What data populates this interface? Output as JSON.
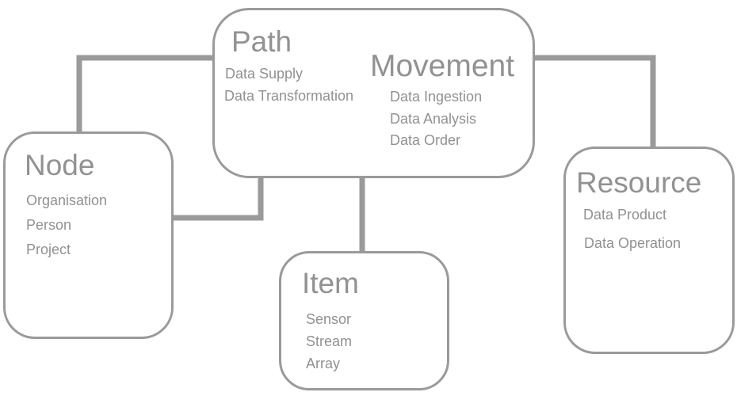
{
  "colors": {
    "line": "#9a9a9a",
    "text": "#919191"
  },
  "nodes": {
    "path": {
      "title": "Path",
      "items": [
        "Data Supply",
        "Data Transformation"
      ]
    },
    "movement": {
      "title": "Movement",
      "items": [
        "Data Ingestion",
        "Data Analysis",
        "Data Order"
      ]
    },
    "node": {
      "title": "Node",
      "items": [
        "Organisation",
        "Person",
        "Project"
      ]
    },
    "item": {
      "title": "Item",
      "items": [
        "Sensor",
        "Stream",
        "Array"
      ]
    },
    "resource": {
      "title": "Resource",
      "items": [
        "Data Product",
        "Data Operation"
      ]
    }
  },
  "edges": [
    {
      "from": "path-movement",
      "to": "node"
    },
    {
      "from": "path-movement",
      "to": "node"
    },
    {
      "from": "path-movement",
      "to": "item"
    },
    {
      "from": "path-movement",
      "to": "resource"
    }
  ]
}
